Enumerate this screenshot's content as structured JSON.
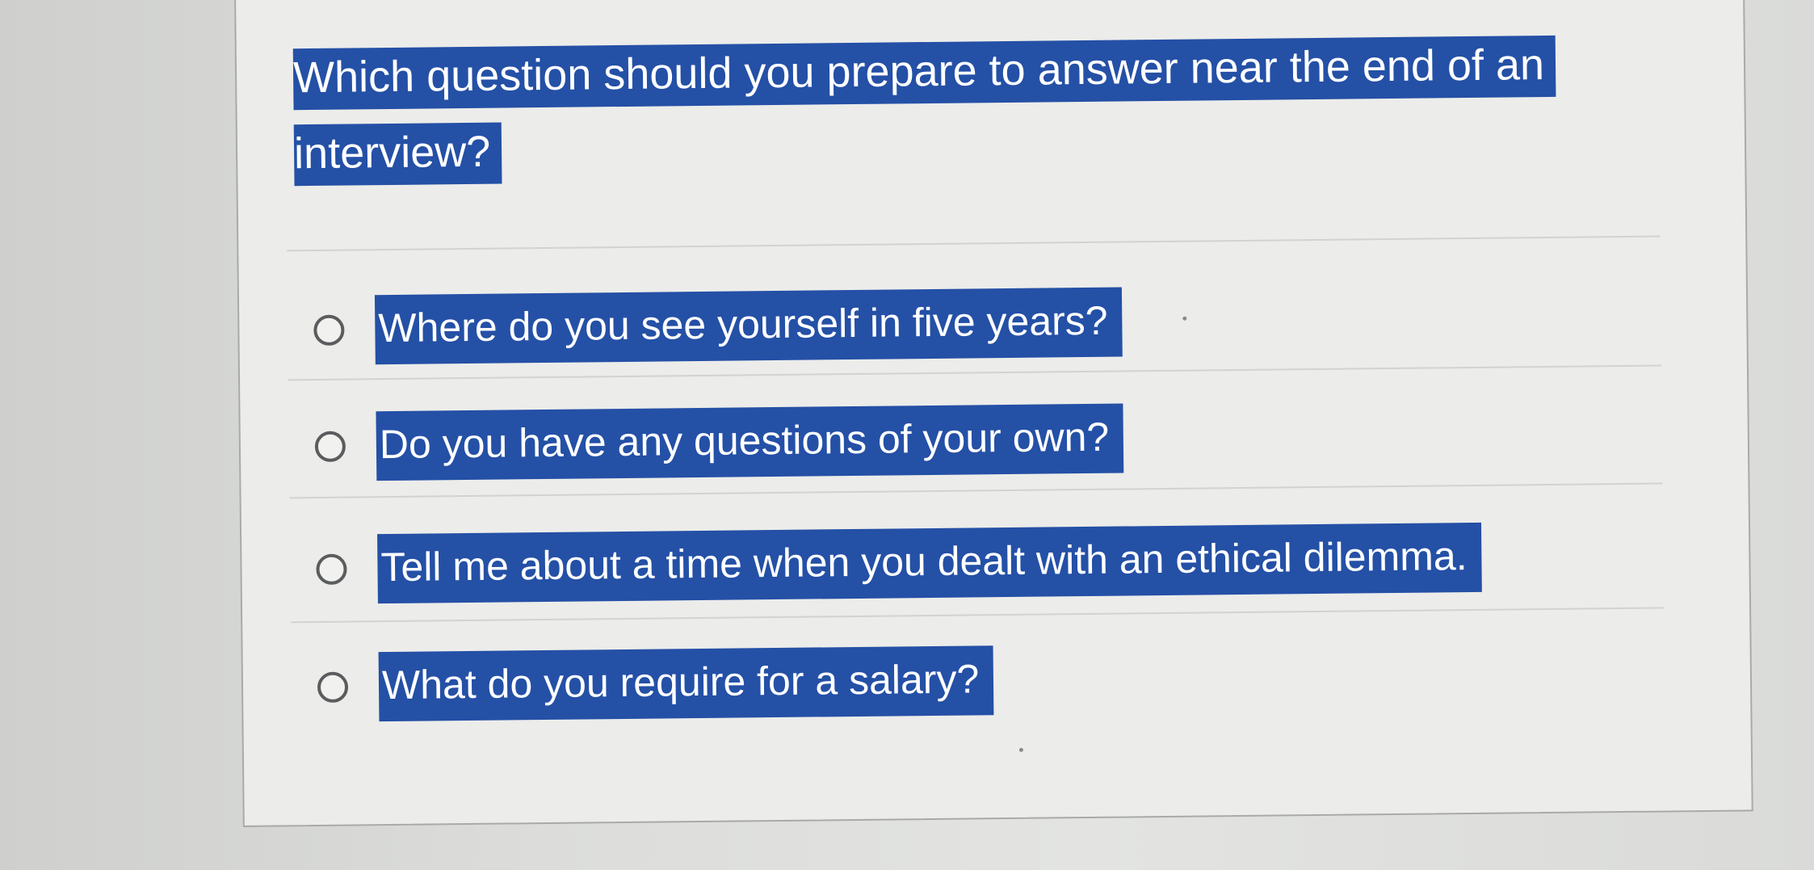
{
  "question": {
    "text": "Which question should you prepare to answer near the end of an interview?"
  },
  "options": [
    {
      "label": "Where do you see yourself in five years?"
    },
    {
      "label": "Do you have any questions of your own?"
    },
    {
      "label": "Tell me about a time when you dealt with an ethical dilemma."
    },
    {
      "label": "What do you require for a salary?"
    }
  ],
  "colors": {
    "highlight": "#2450a6",
    "highlight_text": "#ffffff",
    "card_background": "#ececea",
    "radio_border": "#5a5c5e"
  }
}
